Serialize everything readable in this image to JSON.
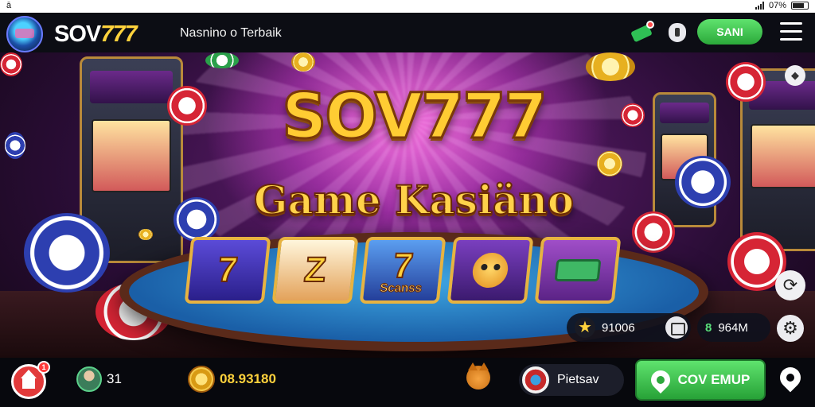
{
  "status_bar": {
    "left_glyph": "ā",
    "battery_text": "07%"
  },
  "header": {
    "brand_white": "SOV",
    "brand_yellow": "777",
    "tagline": "Nasnino o Terbaik",
    "signin_label": "SANI",
    "icons": [
      "money-icon",
      "shield-icon",
      "menu-icon"
    ]
  },
  "hero": {
    "title_line1": "SOV777",
    "title_line2": "Game Kasiäno",
    "reels": [
      {
        "symbol": "7",
        "caption": ""
      },
      {
        "symbol": "Z",
        "caption": ""
      },
      {
        "symbol": "7",
        "caption": "Scanss"
      },
      {
        "symbol": "",
        "caption": ""
      },
      {
        "symbol": "",
        "caption": ""
      }
    ],
    "coin_pill_value": "91006",
    "gem_pill_value": "964M",
    "gem_symbol": "8"
  },
  "bottom_bar": {
    "home_badge": "1",
    "level": "31",
    "balance": "08.93180",
    "player_name": "Pietsav",
    "join_label": "COV EMUP"
  },
  "colors": {
    "accent_gold": "#ffd23c",
    "accent_green": "#2ba83a",
    "badge_red": "#e23a3a"
  }
}
